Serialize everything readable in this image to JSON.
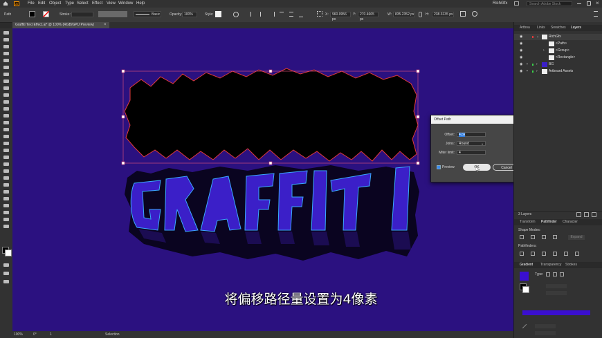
{
  "menubar": {
    "app_icon": "Ai",
    "items": [
      "File",
      "Edit",
      "Object",
      "Type",
      "Select",
      "Effect",
      "View",
      "Window",
      "Help"
    ],
    "workspace": "RichGfx",
    "search_placeholder": "Search Adobe Stock"
  },
  "controlbar": {
    "selection_label": "Path",
    "stroke_label": "Stroke:",
    "brush_label": "Basic",
    "opacity_label": "Opacity:",
    "opacity_value": "100%",
    "style_label": "Style:",
    "x_label": "X:",
    "x_value": "960.0956 px",
    "y_label": "Y:",
    "y_value": "270.4665 px",
    "w_label": "W:",
    "w_value": "835.2352 px",
    "h_label": "H:",
    "h_value": "238.3135 px"
  },
  "document": {
    "tab_title": "Graffiti Text Effect.ai* @ 100% (RGB/GPU Preview)",
    "canvas_color": "#2b1180"
  },
  "dialog": {
    "title": "Offset Path",
    "offset_label": "Offset:",
    "offset_value": "4 px",
    "joins_label": "Joins:",
    "joins_value": "Round",
    "miter_label": "Miter limit:",
    "miter_value": "4",
    "preview_label": "Preview",
    "ok_label": "OK",
    "cancel_label": "Cancel"
  },
  "layers_panel": {
    "tabs": [
      "Artboa",
      "Links",
      "Swatches",
      "Layers"
    ],
    "active_tab": "Layers",
    "rows": [
      {
        "name": "RichGfx",
        "indent": 0
      },
      {
        "name": "<Path>",
        "indent": 2
      },
      {
        "name": "<Group>",
        "indent": 2
      },
      {
        "name": "<Rectangle>",
        "indent": 2
      },
      {
        "name": "BG",
        "indent": 1
      },
      {
        "name": "Artboard Assets",
        "indent": 1
      }
    ],
    "count": "3 Layers"
  },
  "pathfinder_panel": {
    "tabs": [
      "Transform",
      "Pathfinder",
      "Character"
    ],
    "active_tab": "Pathfinder",
    "shape_modes_label": "Shape Modes:",
    "pathfinders_label": "Pathfinders:",
    "expand_label": "Expand"
  },
  "gradient_panel": {
    "tabs": [
      "Gradient",
      "Transparency",
      "Strokes"
    ],
    "active_tab": "Gradient",
    "type_label": "Type:",
    "color": "#3a0fd0"
  },
  "statusbar": {
    "zoom": "100%",
    "rotation": "0°",
    "artboard": "1",
    "tool": "Selection"
  },
  "artwork": {
    "word": "GRAFFITI",
    "letter_fill": "#3b1fc8",
    "letter_highlight": "#3aa8ff",
    "outline_stroke": "#e23a3a"
  },
  "subtitle": "将偏移路径量设置为4像素"
}
